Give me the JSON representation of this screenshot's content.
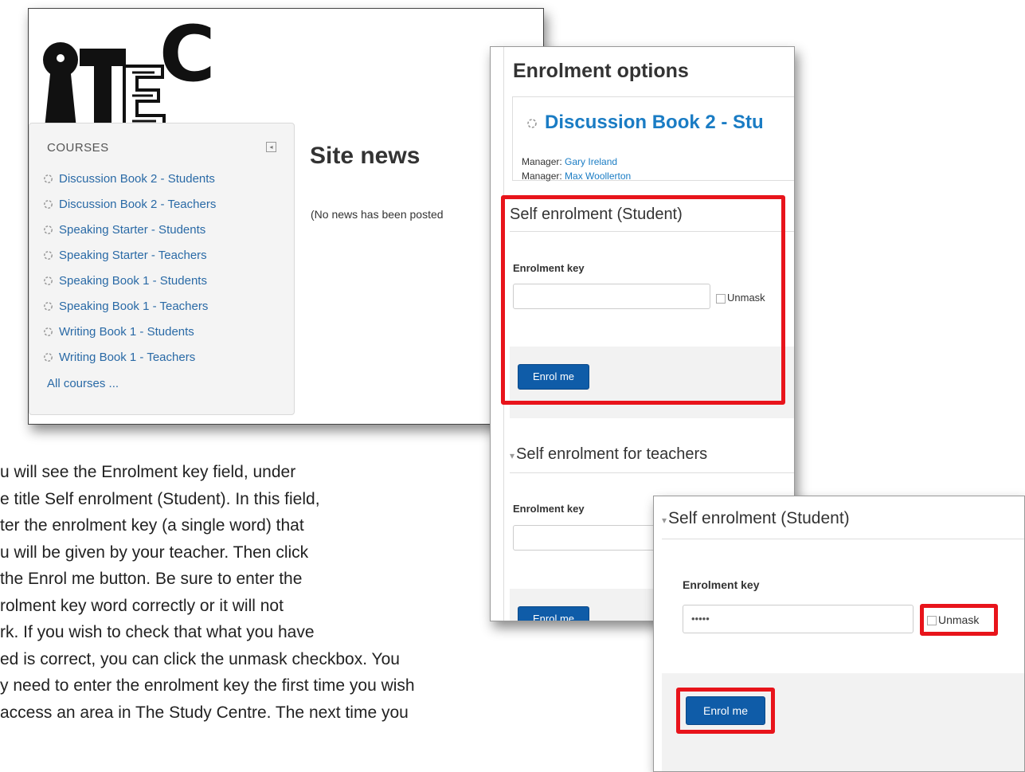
{
  "site": {
    "logo_letter": "C",
    "courses_header": "COURSES",
    "courses": [
      "Discussion Book 2 - Students",
      "Discussion Book 2 - Teachers",
      "Speaking Starter - Students",
      "Speaking Starter - Teachers",
      "Speaking Book 1 - Students",
      "Speaking Book 1 - Teachers",
      "Writing Book 1 - Students",
      "Writing Book 1 - Teachers"
    ],
    "all_courses": "All courses ...",
    "site_news_title": "Site news",
    "no_news_text": "(No news has been posted"
  },
  "enrolment": {
    "title": "Enrolment options",
    "course_title": "Discussion Book 2 - Stu",
    "manager_label": "Manager:",
    "managers": [
      "Gary Ireland",
      "Max Woollerton"
    ],
    "section_student": "Self enrolment (Student)",
    "section_teachers": "Self enrolment for teachers",
    "key_label": "Enrolment key",
    "unmask_label": "Unmask",
    "enrol_button": "Enrol me"
  },
  "zoom": {
    "section_student": "Self enrolment (Student)",
    "key_label": "Enrolment key",
    "key_value": "•••••",
    "unmask_label": "Unmask",
    "enrol_button": "Enrol me"
  },
  "instructions": {
    "lines": [
      "u will see the Enrolment key field, under",
      "e title Self enrolment (Student). In this field,",
      "ter the enrolment key (a single word) that",
      "u will be given by your teacher. Then click",
      " the Enrol me button. Be sure to enter the",
      "rolment key word correctly or it will not",
      "rk. If you wish to check that what you have",
      "ed is correct, you can click the unmask checkbox. You",
      "y need to enter the enrolment key the first time you wish",
      "access an area in The Study Centre. The next time you"
    ]
  },
  "colors": {
    "link": "#2a6aa6",
    "heading_link": "#1a7cc4",
    "button": "#0f5ca8",
    "highlight": "#e8141b"
  }
}
